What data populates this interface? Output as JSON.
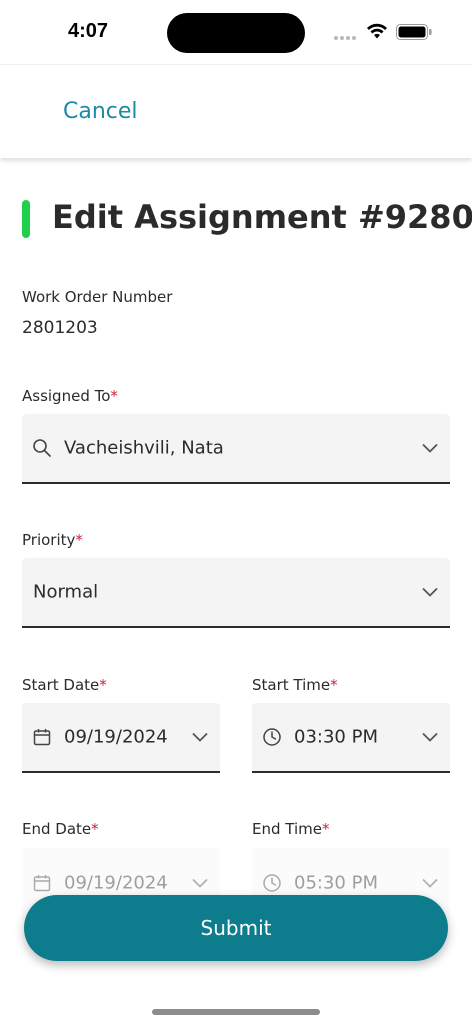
{
  "status_bar": {
    "time": "4:07"
  },
  "nav": {
    "cancel_label": "Cancel"
  },
  "page": {
    "title": "Edit Assignment #9280",
    "accent_color": "#1fd14a"
  },
  "work_order": {
    "label": "Work Order Number",
    "value": "2801203"
  },
  "assigned_to": {
    "label": "Assigned To",
    "required_mark": "*",
    "value": "Vacheishvili, Nata",
    "icon": "search-icon"
  },
  "priority": {
    "label": "Priority",
    "required_mark": "*",
    "value": "Normal"
  },
  "start_date": {
    "label": "Start Date",
    "required_mark": "*",
    "value": "09/19/2024",
    "icon": "calendar-icon"
  },
  "start_time": {
    "label": "Start Time",
    "required_mark": "*",
    "value": "03:30 PM",
    "icon": "clock-icon"
  },
  "end_date": {
    "label": "End Date",
    "required_mark": "*",
    "value": "09/19/2024",
    "icon": "calendar-icon"
  },
  "end_time": {
    "label": "End Time",
    "required_mark": "*",
    "value": "05:30 PM",
    "icon": "clock-icon"
  },
  "submit": {
    "label": "Submit",
    "color": "#0d7c8c"
  },
  "colors": {
    "link": "#1b8aa6",
    "required": "#c0283c"
  }
}
